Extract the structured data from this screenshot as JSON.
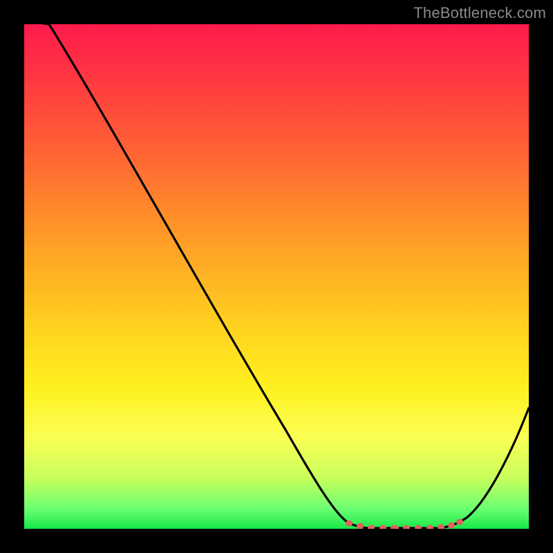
{
  "watermark": "TheBottleneck.com",
  "chart_data": {
    "type": "line",
    "title": "",
    "xlabel": "",
    "ylabel": "",
    "xlim": [
      0,
      100
    ],
    "ylim": [
      0,
      100
    ],
    "background_gradient": {
      "top": "#ff1a4d",
      "bottom": "#17e84a"
    },
    "series": [
      {
        "name": "bottleneck-curve",
        "color": "#000000",
        "x": [
          5,
          10,
          15,
          20,
          25,
          30,
          35,
          40,
          45,
          50,
          55,
          60,
          63,
          66,
          69,
          72,
          75,
          78,
          81,
          84,
          88,
          92,
          96,
          100
        ],
        "y": [
          100,
          91,
          82,
          73,
          64,
          55,
          46,
          37,
          28,
          19,
          11,
          4,
          1.5,
          0.5,
          0,
          0,
          0,
          0,
          0.5,
          2,
          7,
          15,
          25,
          37
        ]
      },
      {
        "name": "optimal-region-markers",
        "color": "#e85a5a",
        "type": "scatter",
        "x": [
          63,
          65.5,
          68,
          70.5,
          73,
          75.5,
          78,
          80.5,
          83
        ],
        "y": [
          1.2,
          0.6,
          0.2,
          0.0,
          0.0,
          0.0,
          0.1,
          0.5,
          1.4
        ]
      }
    ]
  }
}
